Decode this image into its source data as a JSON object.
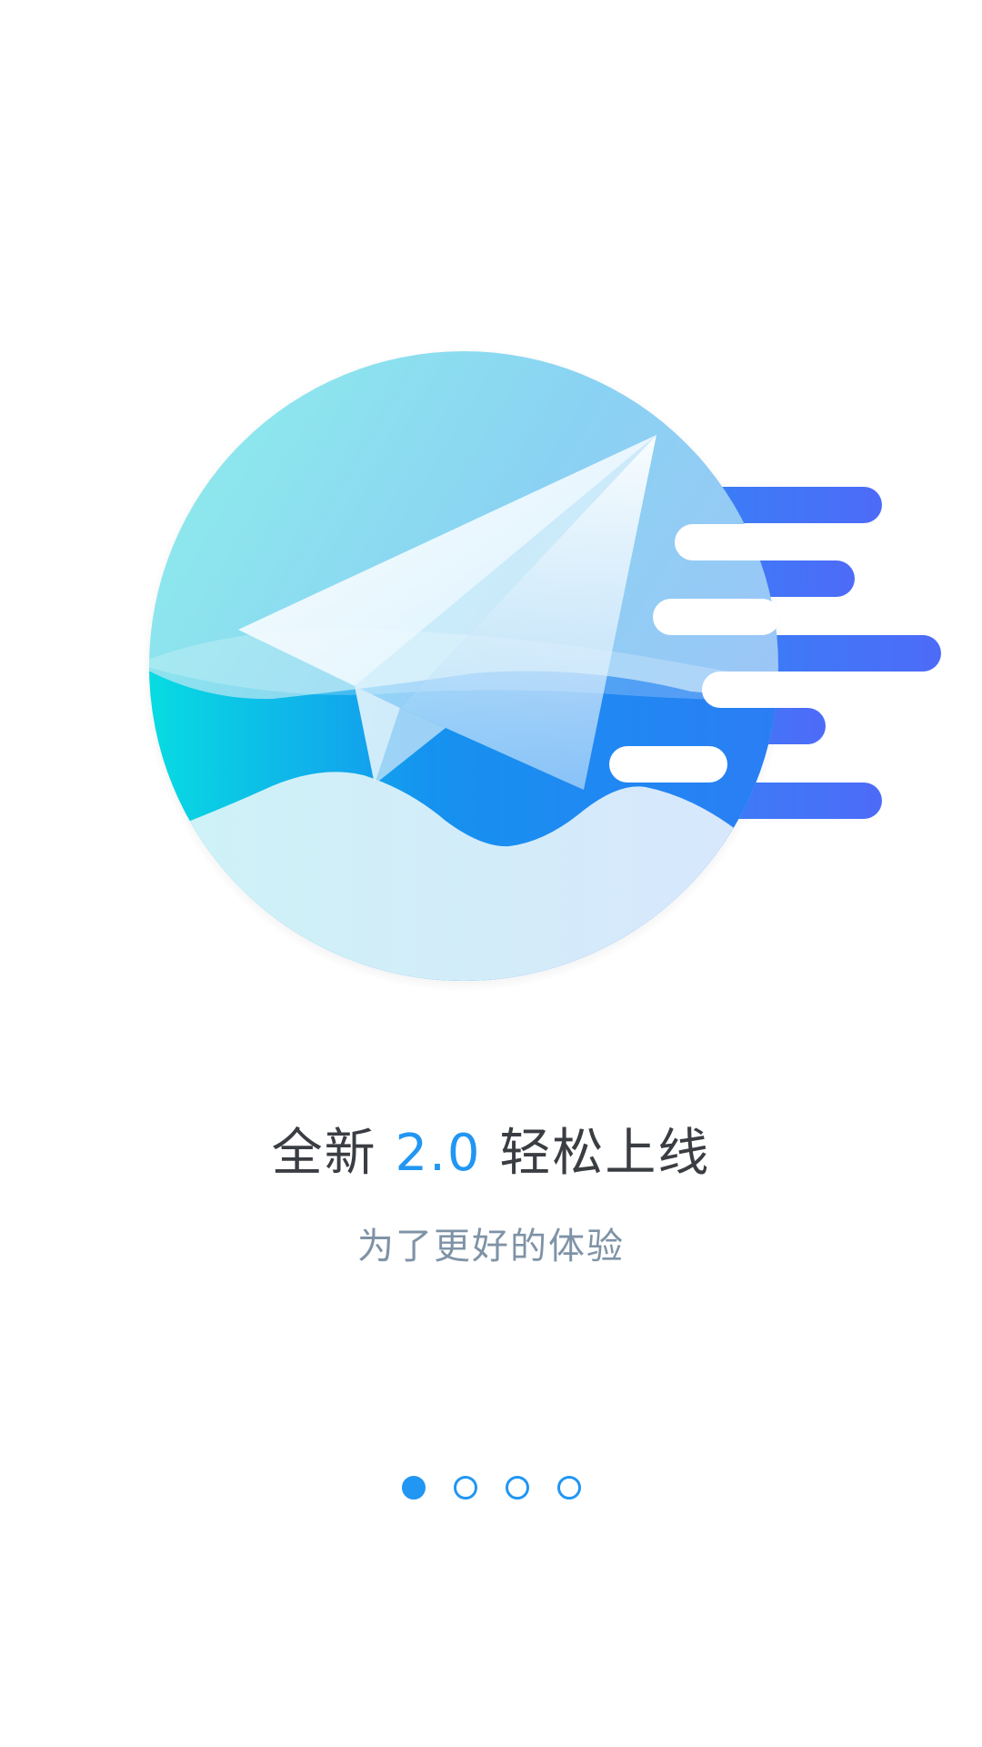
{
  "hero": {
    "illustration": "paper-plane-over-waves",
    "colors": {
      "sky_light": "#8ff0ea",
      "sky_mid": "#8ad2f3",
      "sky_right": "#9ec4f7",
      "water_cyan": "#07dfe1",
      "water_blue": "#1592f0",
      "foam_light": "#d3edfb",
      "streak_blue": "#2c8bf5",
      "streak_violet": "#4d6bf8"
    }
  },
  "headline": {
    "prefix": "全新 ",
    "version": "2.0",
    "suffix": " 轻松上线",
    "accent_color": "#2196f3"
  },
  "subtitle": "为了更好的体验",
  "pager": {
    "total": 4,
    "active_index": 0,
    "color": "#2196f3"
  }
}
